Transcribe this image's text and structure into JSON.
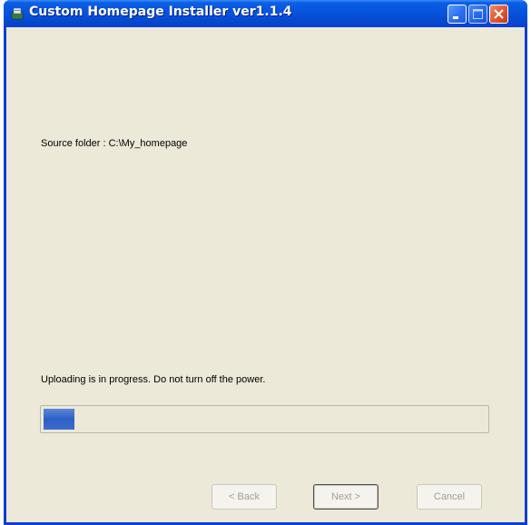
{
  "window": {
    "title": "Custom Homepage Installer ver1.1.4",
    "icon": "installer-app-icon",
    "controls": {
      "minimize": "minimize-icon",
      "maximize": "maximize-icon",
      "close": "close-icon"
    }
  },
  "main": {
    "source_label": "Source folder : C:\\My_homepage",
    "status_text": "Uploading is in progress. Do not turn off the power.",
    "progress_fraction": 0.07
  },
  "buttons": {
    "back": "< Back",
    "next": "Next >",
    "cancel": "Cancel"
  },
  "colors": {
    "titlebar": "#0753dc",
    "client_bg": "#ece9d8",
    "progress_fill": "#2d5fc4",
    "disabled_text": "#a3a192"
  }
}
